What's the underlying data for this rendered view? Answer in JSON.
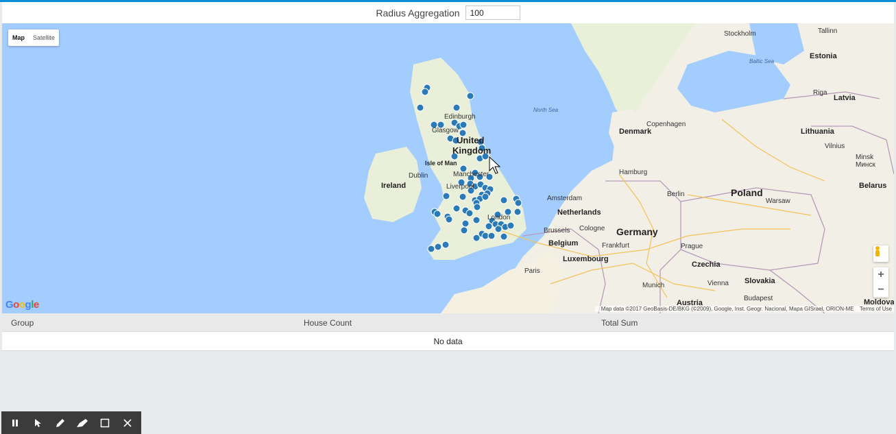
{
  "header": {
    "label": "Radius Aggregation",
    "radius_value": "100"
  },
  "map": {
    "type_buttons": {
      "map": "Map",
      "satellite": "Satellite"
    },
    "zoom_in": "+",
    "zoom_out": "−",
    "attribution": "Map data ©2017 GeoBasis-DE/BKG (©2009), Google, Inst. Geogr. Nacional, Mapa GISrael, ORION-ME",
    "terms": "Terms of Use",
    "logo": "Google",
    "labels": {
      "north_sea": "North Sea",
      "baltic_sea": "Baltic Sea",
      "stockholm": "Stockholm",
      "tallinn": "Tallinn",
      "estonia": "Estonia",
      "riga": "Riga",
      "latvia": "Latvia",
      "lithuania": "Lithuania",
      "vilnius": "Vilnius",
      "minsk": "Minsk",
      "minsk_cyr": "Минск",
      "belarus": "Belarus",
      "denmark": "Denmark",
      "copenhagen": "Copenhagen",
      "hamburg": "Hamburg",
      "berlin": "Berlin",
      "poland": "Poland",
      "warsaw": "Warsaw",
      "amsterdam": "Amsterdam",
      "netherlands": "Netherlands",
      "brussels": "Brussels",
      "belgium": "Belgium",
      "cologne": "Cologne",
      "germany": "Germany",
      "frankfurt": "Frankfurt",
      "luxembourg": "Luxembourg",
      "paris": "Paris",
      "prague": "Prague",
      "czechia": "Czechia",
      "munich": "Munich",
      "vienna": "Vienna",
      "slovakia": "Slovakia",
      "budapest": "Budapest",
      "austria": "Austria",
      "moldova": "Moldova",
      "ireland": "Ireland",
      "dublin": "Dublin",
      "isle_of_man": "Isle of Man",
      "edinburgh": "Edinburgh",
      "glasgow": "Glasgow",
      "united_kingdom_1": "United",
      "united_kingdom_2": "Kingdom",
      "manchester": "Manchester",
      "liverpool": "Liverpool",
      "london": "London"
    }
  },
  "table": {
    "columns": [
      "Group",
      "House Count",
      "Total Sum"
    ],
    "empty_text": "No data"
  },
  "colors": {
    "accent": "#0a8fd6",
    "marker": "#2a7ab8",
    "water": "#a3ccff",
    "land": "#f2efe6",
    "toolbar": "#3b3b3b"
  }
}
